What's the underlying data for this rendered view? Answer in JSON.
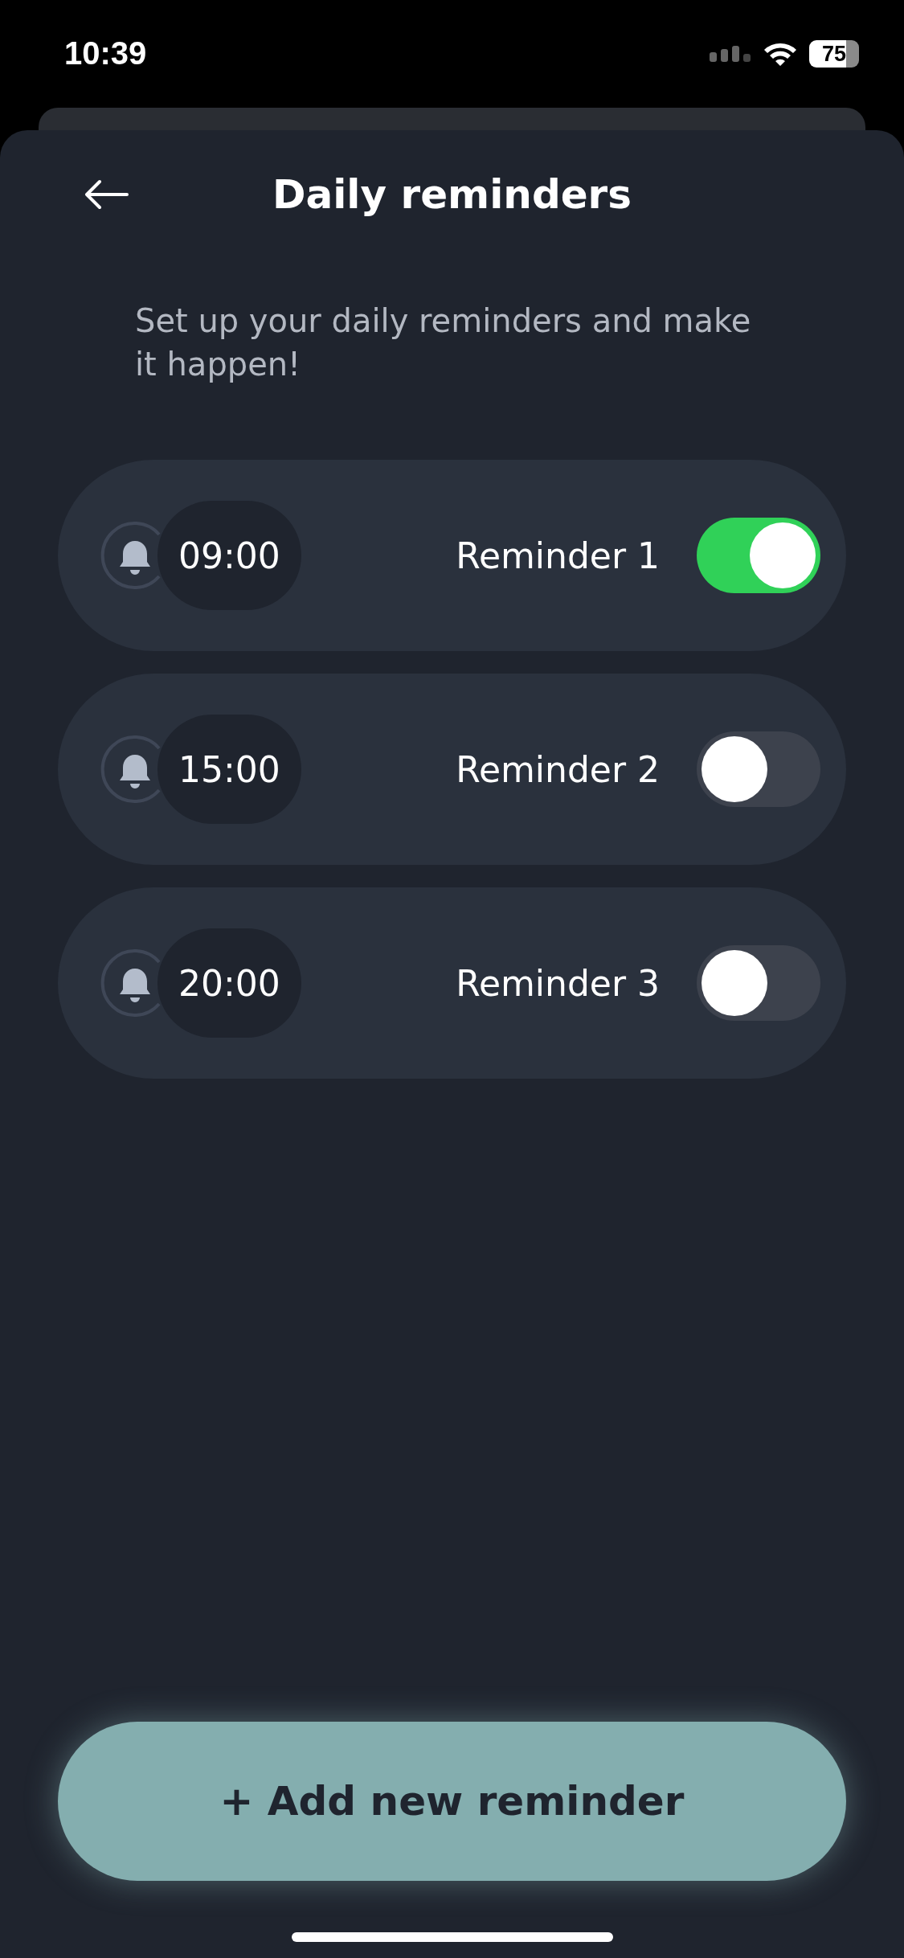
{
  "status_bar": {
    "time": "10:39",
    "battery": "75"
  },
  "header": {
    "title": "Daily reminders"
  },
  "subtitle": "Set up your daily reminders and make it happen!",
  "reminders": [
    {
      "time": "09:00",
      "label": "Reminder 1",
      "on": true
    },
    {
      "time": "15:00",
      "label": "Reminder 2",
      "on": false
    },
    {
      "time": "20:00",
      "label": "Reminder 3",
      "on": false
    }
  ],
  "add_button": "+ Add new reminder"
}
